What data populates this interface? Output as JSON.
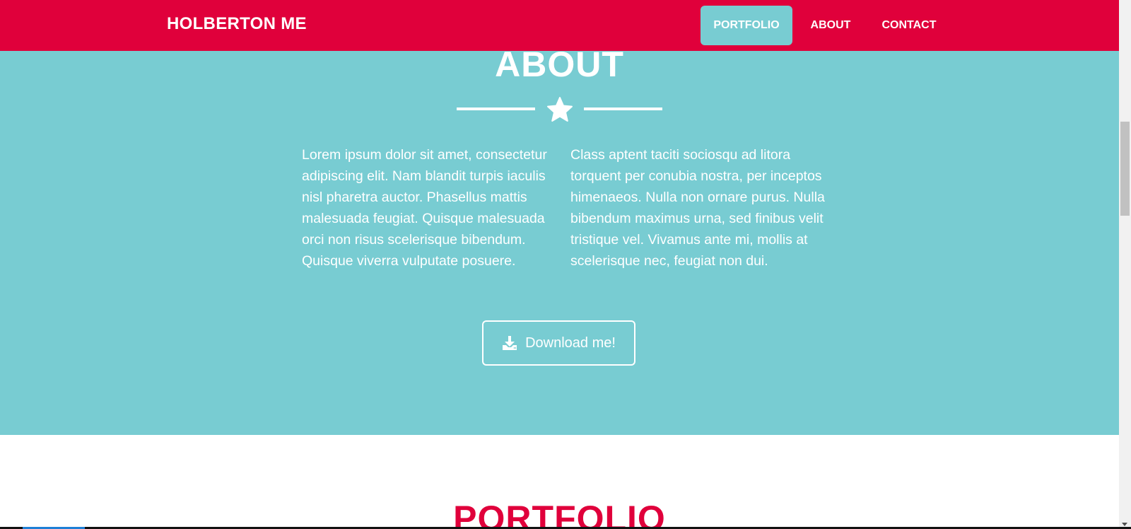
{
  "colors": {
    "navbar": "#e0003b",
    "accent": "#78ccd2",
    "portfolio_title": "#e0003b",
    "text_light": "#ffffff"
  },
  "navbar": {
    "brand": "HOLBERTON ME",
    "links": [
      {
        "label": "PORTFOLIO",
        "active": true
      },
      {
        "label": "ABOUT",
        "active": false
      },
      {
        "label": "CONTACT",
        "active": false
      }
    ]
  },
  "about": {
    "title": "ABOUT",
    "divider_icon": "star-icon",
    "paragraph_left": "Lorem ipsum dolor sit amet, consectetur adipiscing elit. Nam blandit turpis iaculis nisl pharetra auctor. Phasellus mattis malesuada feugiat. Quisque malesuada orci non risus scelerisque bibendum. Quisque viverra vulputate posuere.",
    "paragraph_right": "Class aptent taciti sociosqu ad litora torquent per conubia nostra, per inceptos himenaeos. Nulla non ornare purus. Nulla bibendum maximus urna, sed finibus velit tristique vel. Vivamus ante mi, mollis at scelerisque nec, feugiat non dui.",
    "download_button": {
      "label": "Download me!",
      "icon": "download-icon"
    }
  },
  "portfolio": {
    "title": "PORTFOLIO"
  }
}
